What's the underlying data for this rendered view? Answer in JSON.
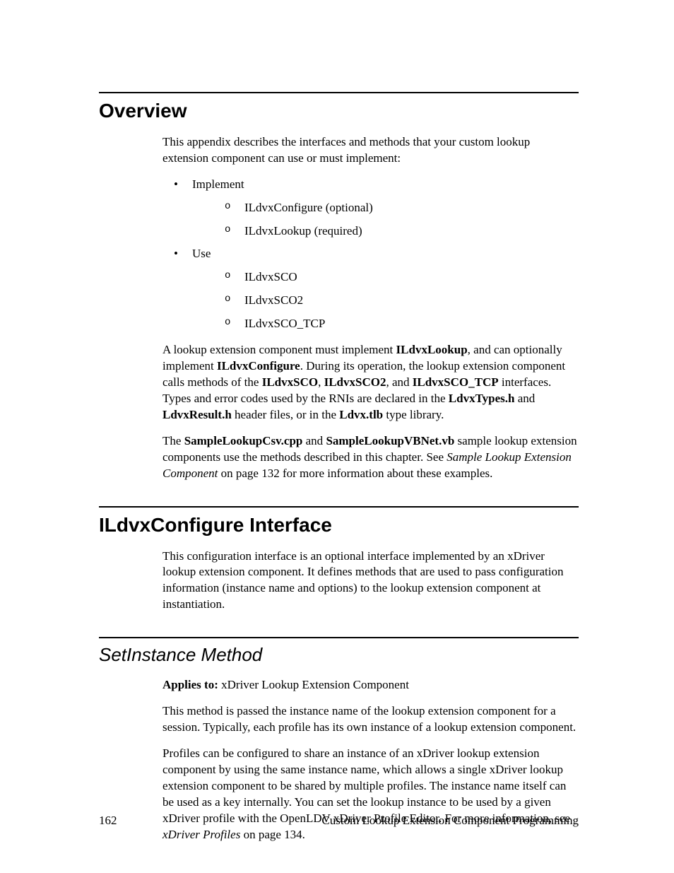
{
  "overview": {
    "heading": "Overview",
    "intro": "This appendix describes the interfaces and methods that your custom lookup extension component can use or must implement:",
    "list": {
      "item1": {
        "label": "Implement",
        "sub1": "ILdvxConfigure (optional)",
        "sub2": "ILdvxLookup (required)"
      },
      "item2": {
        "label": "Use",
        "sub1": "ILdvxSCO",
        "sub2": "ILdvxSCO2",
        "sub3": "ILdvxSCO_TCP"
      }
    },
    "para2": {
      "t1": "A lookup extension component must implement ",
      "b1": "ILdvxLookup",
      "t2": ", and can optionally implement ",
      "b2": "ILdvxConfigure",
      "t3": ".  During its operation, the lookup extension component calls methods of the ",
      "b3": "ILdvxSCO",
      "t4": ", ",
      "b4": "ILdvxSCO2",
      "t5": ", and ",
      "b5": "ILdvxSCO_TCP",
      "t6": " interfaces.  Types and error codes used by the RNIs are declared in the ",
      "b6": "LdvxTypes.h",
      "t7": " and ",
      "b7": "LdvxResult.h",
      "t8": " header files, or in the ",
      "b8": "Ldvx.tlb",
      "t9": " type library."
    },
    "para3": {
      "t1": "The ",
      "b1": "SampleLookupCsv.cpp",
      "t2": " and ",
      "b2": "SampleLookupVBNet.vb",
      "t3": " sample lookup extension components use the methods described in this chapter.  See ",
      "i1": "Sample Lookup Extension Component",
      "t4": " on page 132 for more information about these examples."
    }
  },
  "ildvx": {
    "heading": "ILdvxConfigure Interface",
    "para": "This configuration interface is an optional interface implemented by an xDriver lookup extension component.  It defines methods that are used to pass configuration information (instance name and options) to the lookup extension component at instantiation."
  },
  "setinstance": {
    "heading": "SetInstance Method",
    "applies_label": "Applies to:",
    "applies_value": "  xDriver Lookup Extension Component",
    "para1": "This method is passed the instance name of the lookup extension component for a session.  Typically, each profile has its own instance of a lookup extension component.",
    "para2": {
      "t1": "Profiles can be configured to share an instance of an xDriver lookup extension component by using the same instance name, which allows a single xDriver lookup extension component to be shared by multiple profiles.  The instance name itself can be used as a key internally.  You can set the lookup instance to be used by a given xDriver profile with the OpenLDV xDriver Profile Editor.  For more information, see ",
      "i1": "xDriver Profiles",
      "t2": " on page 134."
    }
  },
  "footer": {
    "page": "162",
    "title": "Custom Lookup Extension Component Programming"
  }
}
